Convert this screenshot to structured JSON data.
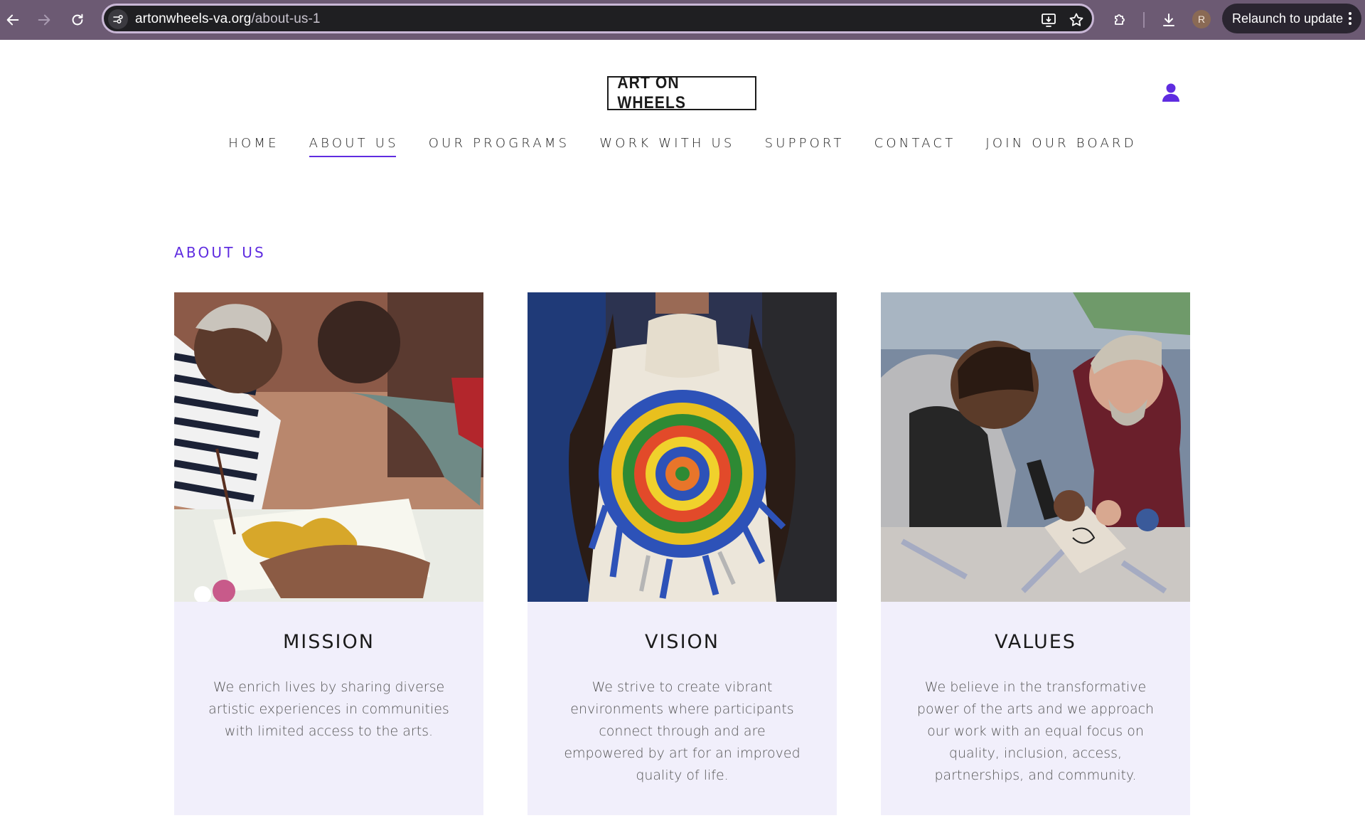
{
  "browser": {
    "url_domain": "artonwheels-va.org",
    "url_path": "/about-us-1",
    "avatar_initial": "R",
    "relaunch_label": "Relaunch to update",
    "icons": [
      "back-icon",
      "forward-icon",
      "reload-icon",
      "site-info-icon",
      "install-app-icon",
      "bookmark-star-icon",
      "extensions-icon",
      "downloads-icon",
      "kebab-menu-icon"
    ]
  },
  "site": {
    "logo": "ART ON WHEELS",
    "nav": [
      "HOME",
      "ABOUT US",
      "OUR PROGRAMS",
      "WORK WITH US",
      "SUPPORT",
      "CONTACT",
      "JOIN OUR BOARD"
    ],
    "active_nav": "ABOUT US",
    "accent_color": "#5f2ce0"
  },
  "main": {
    "section_title": "ABOUT US",
    "cards": [
      {
        "heading": "MISSION",
        "text": "We enrich lives by sharing diverse artistic experiences in communities with limited access to the arts.",
        "image_alt": "Older woman painting with a helper"
      },
      {
        "heading": "VISION",
        "text": "We strive to create vibrant environments where participants connect through and are empowered by art for an improved quality of life.",
        "image_alt": "Person holding a colorful woven fabric circle"
      },
      {
        "heading": "VALUES",
        "text": "We believe in the transformative power of the arts and we approach our work with an equal focus on quality, inclusion, access, partnerships, and community.",
        "image_alt": "Two men working on a carving print block"
      }
    ]
  }
}
